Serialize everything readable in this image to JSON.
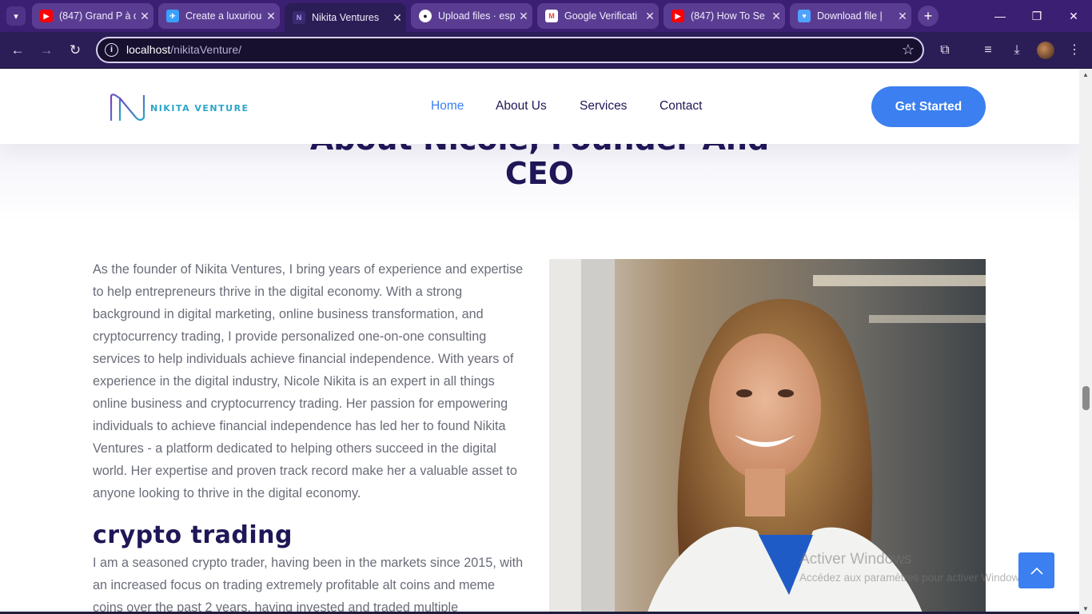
{
  "browser": {
    "tabs": [
      {
        "title": "(847) Grand P à c",
        "favicon": "youtube-icon",
        "color": "#ff0000"
      },
      {
        "title": "Create a luxurious",
        "favicon": "fiverr-icon",
        "color": "#3aa0ff"
      },
      {
        "title": "Nikita Ventures",
        "favicon": "nikita-icon",
        "color": "#7a5ad0",
        "active": true
      },
      {
        "title": "Upload files · esp",
        "favicon": "github-icon",
        "color": "#ffffff"
      },
      {
        "title": "Google Verificati",
        "favicon": "gmail-icon",
        "color": "#ea4335"
      },
      {
        "title": "(847) How To Se",
        "favicon": "youtube-icon",
        "color": "#ff0000"
      },
      {
        "title": "Download file | ",
        "favicon": "download-site-icon",
        "color": "#4da3ff"
      }
    ],
    "url_host": "localhost",
    "url_path": "/nikitaVenture/"
  },
  "site": {
    "logo_text": "NIKITA VENTURE",
    "nav": [
      "Home",
      "About Us",
      "Services",
      "Contact"
    ],
    "cta": "Get Started",
    "heading_line1": "About Nicole, Founder And",
    "heading_line2": "CEO",
    "bio": "As the founder of Nikita Ventures, I bring years of experience and expertise to help entrepreneurs thrive in the digital economy. With a strong background in digital marketing, online business transformation, and cryptocurrency trading, I provide personalized one-on-one consulting services to help individuals achieve financial independence. With years of experience in the digital industry, Nicole Nikita is an expert in all things online business and cryptocurrency trading. Her passion for empowering individuals to achieve financial independence has led her to found Nikita Ventures - a platform dedicated to helping others succeed in the digital world. Her expertise and proven track record make her a valuable asset to anyone looking to thrive in the digital economy.",
    "subheading": "crypto trading",
    "bio2": "I am a seasoned crypto trader, having been in the markets since 2015, with an increased focus on trading extremely profitable alt coins and meme coins over the past 2 years, having invested and traded multiple"
  },
  "watermark": {
    "line1": "Activer Windows",
    "line2": "Accédez aux paramètres pour activer Windows."
  },
  "colors": {
    "accent": "#3b7ff0",
    "heading": "#1f1757",
    "chrome": "#2b1d56"
  }
}
